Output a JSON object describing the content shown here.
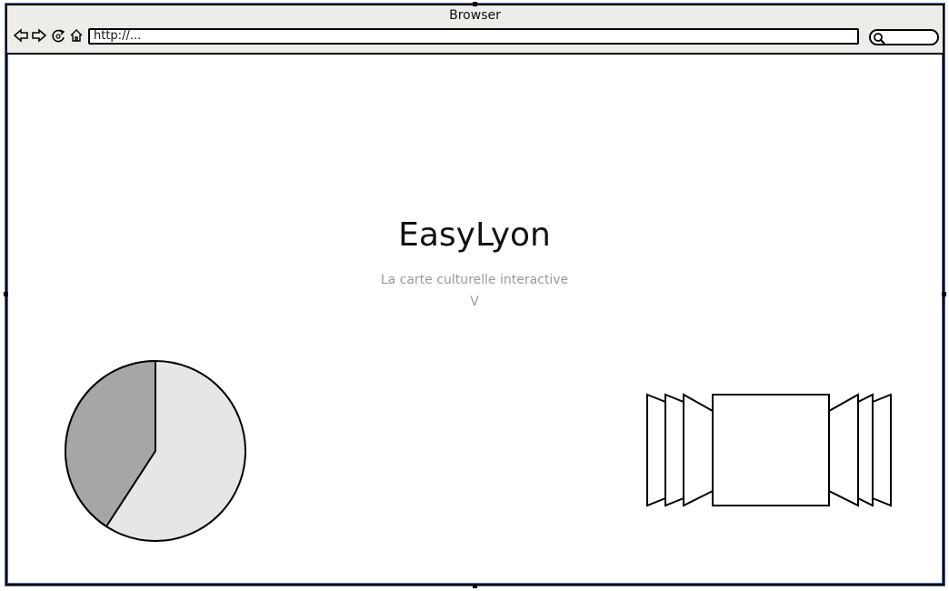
{
  "window": {
    "title": "Browser"
  },
  "toolbar": {
    "back_icon": "back-arrow-icon",
    "forward_icon": "forward-arrow-icon",
    "reload_icon": "reload-icon",
    "home_icon": "home-icon"
  },
  "address_bar": {
    "value": "http://..."
  },
  "search": {
    "icon": "search-icon",
    "value": ""
  },
  "hero": {
    "title": "EasyLyon",
    "subtitle": "La carte culturelle interactive",
    "scroll_indicator": "V"
  },
  "widgets": {
    "pie_chart": "pie-chart-placeholder",
    "cover_flow": "cover-flow-placeholder"
  },
  "colors": {
    "chrome_bg": "#eeece8",
    "frame_accent": "#4a6aa8",
    "pie_dark": "#a6a6a6",
    "pie_light": "#e6e6e6",
    "subtitle_gray": "#9a9a9a"
  }
}
